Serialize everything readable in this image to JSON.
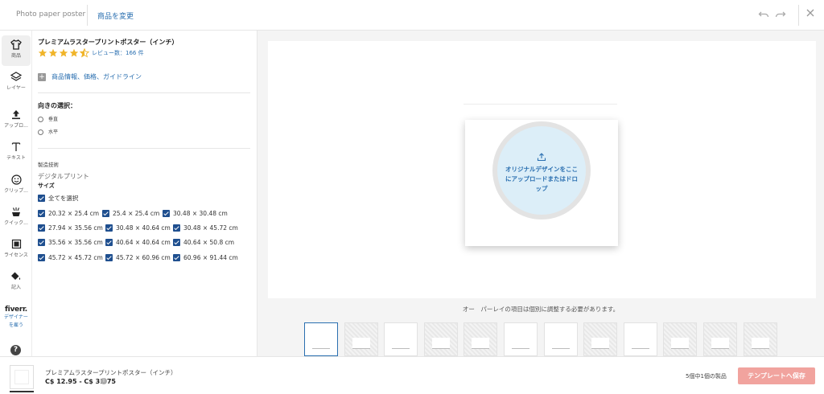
{
  "header": {
    "app_title": "Photo paper poster",
    "change_product": "商品を変更"
  },
  "rail": {
    "items": [
      {
        "label": "商品",
        "icon": "tshirt-icon"
      },
      {
        "label": "レイヤー",
        "icon": "layers-icon"
      },
      {
        "label": "アップロ...",
        "icon": "upload-icon"
      },
      {
        "label": "テキスト",
        "icon": "text-icon"
      },
      {
        "label": "クリップ...",
        "icon": "smiley-icon"
      },
      {
        "label": "クイック...",
        "icon": "quick-design-icon"
      },
      {
        "label": "ライセンス",
        "icon": "license-icon"
      },
      {
        "label": "記入",
        "icon": "paint-bucket-icon"
      }
    ],
    "fiverr_logo": "fiverr.",
    "fiverr_line1": "デザイナー",
    "fiverr_line2": "を雇う",
    "help": "?"
  },
  "panel": {
    "product_title": "プレミアムラスタープリントポスター（インチ）",
    "rating": 4.5,
    "reviews": "レビュー数：166 件",
    "info_link": "商品情報、価格、ガイドライン",
    "orientation_title": "向きの選択：",
    "orientations": [
      "垂直",
      "水平"
    ],
    "tech_header": "製造技術",
    "tech_value": "デジタルプリント",
    "size_header": "サイズ",
    "select_all": "全てを選択",
    "sizes": [
      "20.32 × 25.4 cm",
      "25.4 × 25.4 cm",
      "30.48 × 30.48 cm",
      "27.94 × 35.56 cm",
      "30.48 × 40.64 cm",
      "30.48 × 45.72 cm",
      "35.56 × 35.56 cm",
      "40.64 × 40.64 cm",
      "40.64 × 50.8 cm",
      "45.72 × 45.72 cm",
      "45.72 × 60.96 cm",
      "60.96 × 91.44 cm"
    ]
  },
  "canvas": {
    "drop_text": "オリジナルデザインをここにアップロードまたはドロップ",
    "notice": "オー　パーレイの項目は個別に調整する必要があります。"
  },
  "footer": {
    "product_name": "プレミアムラスタープリントポスター（インチ）",
    "price": "C$ 12.95 - C$ 31.75",
    "count": "5個中1個の製品",
    "save": "テンプレートへ保存"
  },
  "colors": {
    "accent": "#2a6fb0",
    "checkbox": "#1f4f8f",
    "star": "#f0b429",
    "save_button": "#f1a39e",
    "drop_zone": "#dceef8"
  }
}
